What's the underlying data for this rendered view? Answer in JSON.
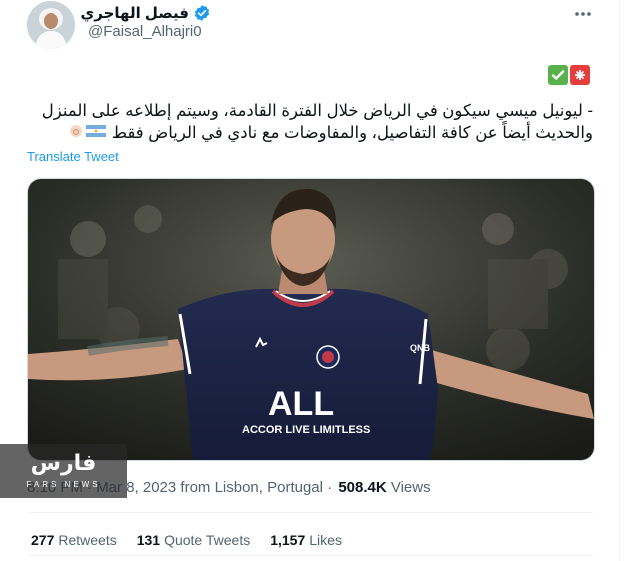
{
  "author": {
    "name": "فيصل الهاجري",
    "handle": "@Faisal_Alhajri0",
    "verified": true
  },
  "icons": {
    "more": "more-horizontal-icon",
    "verified": "verified-badge-icon"
  },
  "emojis_top": [
    "rotating-light-emoji",
    "check-mark-emoji"
  ],
  "tweet": {
    "line1": "- ليونيل ميسي سيكون في الرياض خلال الفترة القادمة، وسيتم إطلاعه على المنزل",
    "line2": "والحديث أيضاً عن كافة التفاصيل، والمفاوضات مع نادي في الرياض فقط",
    "trailing_emojis": [
      "ok-hand-emoji",
      "argentina-flag-emoji"
    ]
  },
  "translate_label": "Translate Tweet",
  "media": {
    "jersey_sponsor": "ALL",
    "jersey_tagline": "ACCOR LIVE LIMITLESS",
    "jersey_brand": "QNB"
  },
  "meta": {
    "time_date": "8:10 PM · Mar 8, 2023 from Lisbon, Portugal",
    "separator": " · ",
    "views_count": "508.4K",
    "views_label": " Views"
  },
  "stats": {
    "retweets_count": "277",
    "retweets_label": "Retweets",
    "quotes_count": "131",
    "quotes_label": "Quote Tweets",
    "likes_count": "1,157",
    "likes_label": "Likes"
  },
  "watermark": {
    "text": "فارس",
    "sub": "FARS NEWS"
  },
  "colors": {
    "accent": "#1d9bf0",
    "secondary_text": "#536471",
    "primary_text": "#0f1419"
  }
}
